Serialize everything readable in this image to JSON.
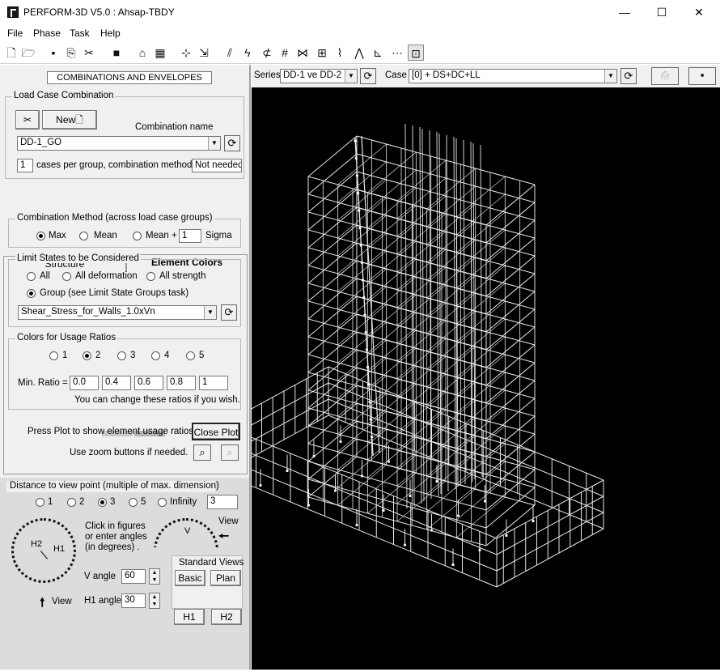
{
  "window": {
    "title": "PERFORM-3D V5.0 : Ahsap-TBDY",
    "minimize": "—",
    "maximize": "☐",
    "close": "✕"
  },
  "menu": [
    "File",
    "Phase",
    "Task",
    "Help"
  ],
  "toolbar_icons": [
    "new-file-icon",
    "open-folder-icon",
    "save-icon",
    "save-as-icon",
    "delete-icon",
    "stop-icon",
    "structure-icon",
    "element-icon",
    "node-icon",
    "load-icon",
    "frame-icon",
    "analysis-icon",
    "wall-icon",
    "grid-icon",
    "deformation-icon",
    "link-icon",
    "curve-icon",
    "time-history-icon",
    "pushover-icon",
    "plot-icon",
    "monitor-icon"
  ],
  "panel_header": "COMBINATIONS AND ENVELOPES",
  "load_case_combination": {
    "title": "Load Case Combination",
    "new_label": "New",
    "name_label": "Combination  name",
    "combination_value": "DD-1_GO",
    "cases_per_group_value": "1",
    "cases_text": "cases per group, combination method =",
    "method_value": "Not needed"
  },
  "tabs": {
    "structure": "Structure",
    "element_colors": "Element Colors"
  },
  "combination_method": {
    "title": "Combination Method (across load case groups)",
    "max": "Max",
    "mean": "Mean",
    "mean_plus": "Mean +",
    "sigma_value": "1",
    "sigma": "Sigma",
    "selected": "Max"
  },
  "limit_states": {
    "title": "Limit States to be Considered",
    "all": "All",
    "all_deformation": "All deformation",
    "all_strength": "All strength",
    "group": "Group (see Limit State Groups task)",
    "group_value": "Shear_Stress_for_Walls_1.0xVn",
    "selected": "Group"
  },
  "usage_ratios": {
    "title": "Colors for Usage Ratios",
    "options": [
      "1",
      "2",
      "3",
      "4",
      "5"
    ],
    "selected": "2",
    "min_ratio_label": "Min. Ratio =",
    "ratios": [
      "0.0",
      "0.4",
      "0.6",
      "0.8",
      "1"
    ],
    "swatch_colors": [
      "#f4f4f4",
      "#c8c8c8",
      "#b4b4b4",
      "#eeeeee",
      "#3c3c3c"
    ],
    "hint": "You can change these ratios if you wish."
  },
  "plot": {
    "press_text": "Press Plot to show element usage ratios.",
    "close_label": "Close Plot",
    "zoom_text": "Use zoom buttons if needed."
  },
  "view_controls": {
    "distance_title": "Distance to view point (multiple of max. dimension)",
    "options": [
      "1",
      "2",
      "3",
      "5",
      "Infinity"
    ],
    "selected": "3",
    "distance_value": "3",
    "click_hint_1": "Click in figures",
    "click_hint_2": "or enter angles",
    "click_hint_3": "(in degrees) .",
    "h2": "H2",
    "h1": "H1",
    "v": "V",
    "view": "View",
    "v_angle_label": "V angle",
    "v_angle_value": "60",
    "h1_angle_label": "H1 angle",
    "h1_angle_value": "30",
    "standard_views": "Standard Views",
    "basic": "Basic",
    "plan": "Plan",
    "h1_button": "H1",
    "h2_button": "H2"
  },
  "series_bar": {
    "series_label": "Series",
    "series_value": "DD-1 ve DD-2",
    "case_label": "Case",
    "case_value": "[0] + DS+DC+LL"
  }
}
